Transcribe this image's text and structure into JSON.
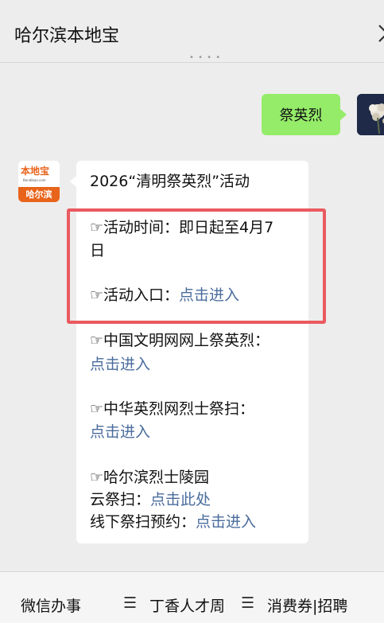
{
  "header": {
    "title": "哈尔滨本地宝",
    "more_icon": "chevron-right-icon"
  },
  "user_message": {
    "text": "祭英烈"
  },
  "bot": {
    "avatar_logo": "本地宝",
    "avatar_sub": "Bendibao.com",
    "avatar_city": "哈尔滨"
  },
  "bot_message": {
    "title": "2026“清明祭英烈”活动",
    "time_line1": "☞活动时间：即日起至4月7",
    "time_line2": "日",
    "entry_label": "☞活动入口：",
    "entry_link": "点击进入",
    "wenming_label": "☞中国文明网网上祭英烈：",
    "wenming_link": "点击进入",
    "zhonghua_label": "☞中华英烈网烈士祭扫：",
    "zhonghua_link": "点击进入",
    "harbin_label": "☞哈尔滨烈士陵园",
    "cloud_label": "云祭扫：",
    "cloud_link": "点击此处",
    "offline_label": "线下祭扫预约：",
    "offline_link": "点击进入"
  },
  "bottom_menu": {
    "item1": "微信办事",
    "item2": "丁香人才周",
    "item3": "消费券|招聘",
    "sep": "☰"
  },
  "colors": {
    "user_bubble": "#95ec69",
    "link": "#4a6c9c",
    "highlight_border": "#ea5a5f",
    "brand_orange": "#e8641b"
  }
}
